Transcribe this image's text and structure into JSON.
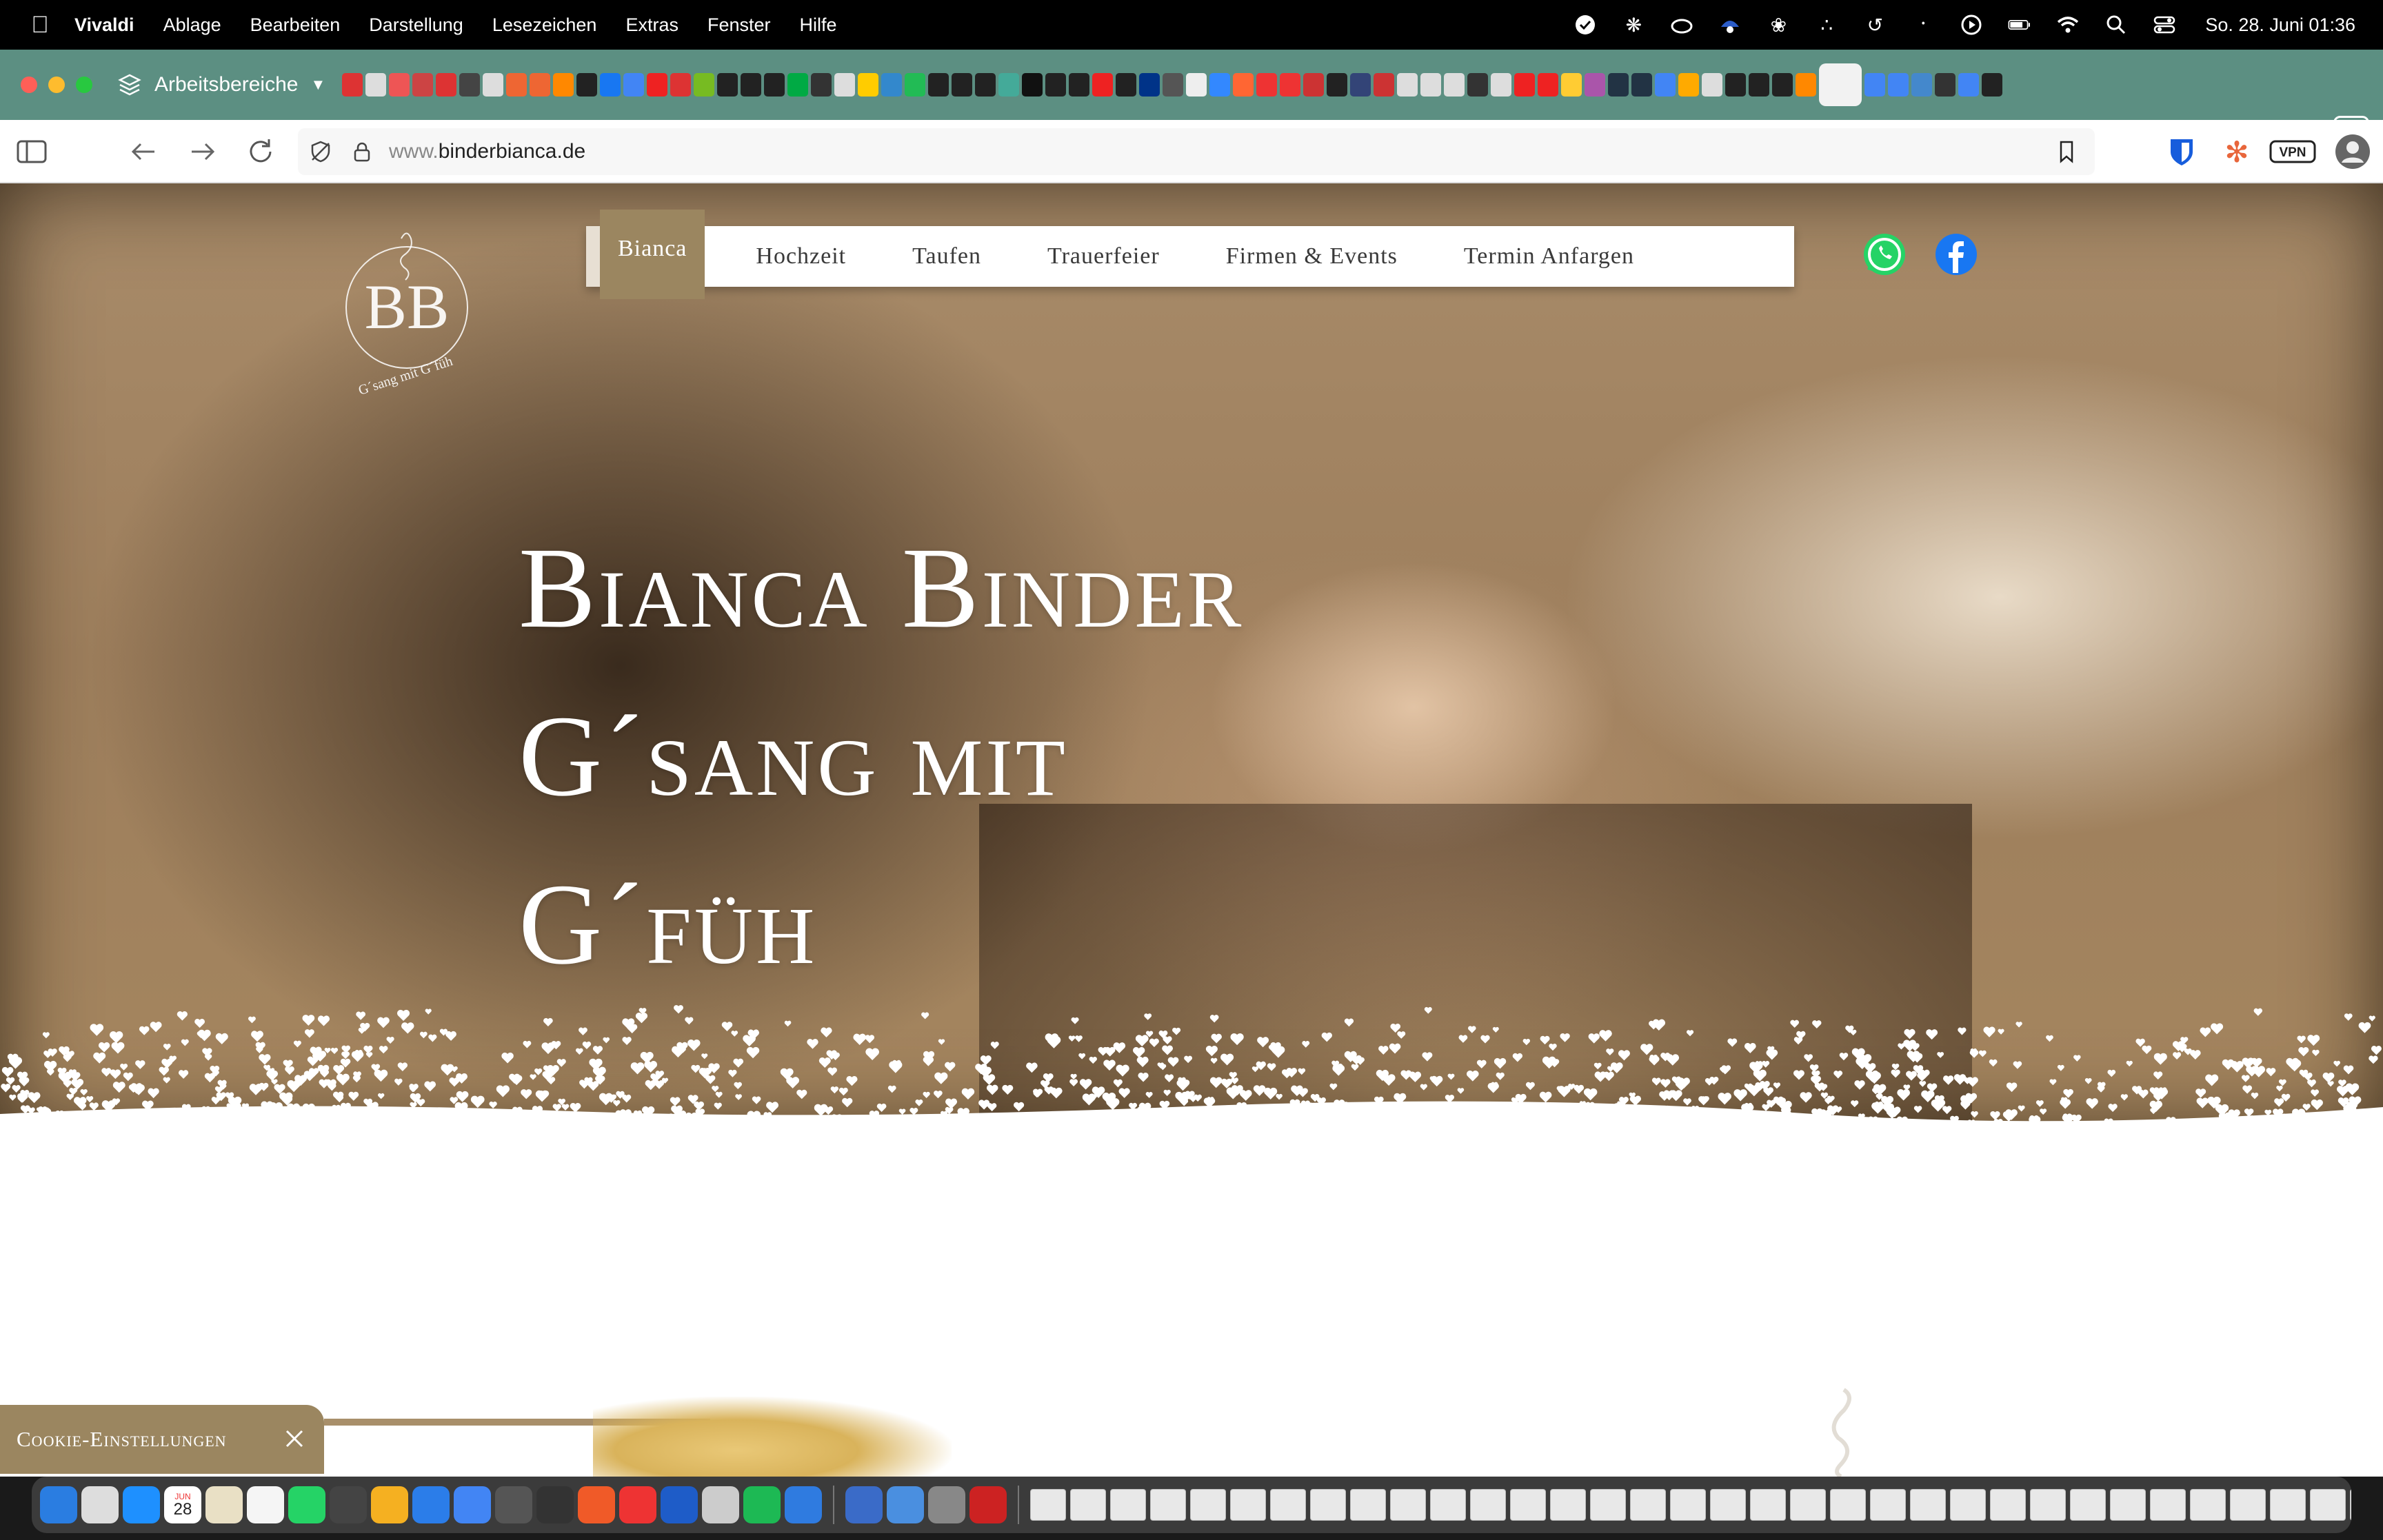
{
  "menubar": {
    "app_name": "Vivaldi",
    "items": [
      "Ablage",
      "Bearbeiten",
      "Darstellung",
      "Lesezeichen",
      "Extras",
      "Fenster",
      "Hilfe"
    ],
    "clock": "So. 28. Juni  01:36"
  },
  "tabbar": {
    "workspace_label": "Arbeitsbereiche",
    "tab_colors": [
      "#d33",
      "#ddd",
      "#e55",
      "#c44",
      "#d33",
      "#444",
      "#ddd",
      "#e63",
      "#e63",
      "#f80",
      "#222",
      "#1877f2",
      "#4285f4",
      "#e22",
      "#d33",
      "#7b2",
      "#222",
      "#222",
      "#222",
      "#0a4",
      "#333",
      "#ddd",
      "#fc0",
      "#38c",
      "#2b5",
      "#222",
      "#222",
      "#222",
      "#4a9",
      "#111",
      "#222",
      "#222",
      "#e22",
      "#222",
      "#038",
      "#555",
      "#eee",
      "#38f",
      "#f63",
      "#e33",
      "#e33",
      "#c33",
      "#222",
      "#347",
      "#c33",
      "#ddd",
      "#ddd",
      "#ddd",
      "#333",
      "#ddd",
      "#e22",
      "#e22",
      "#fc3",
      "#a5a",
      "#234",
      "#234",
      "#4285f4",
      "#fa0",
      "#ddd",
      "#222",
      "#222",
      "#222",
      "#f80",
      "#f2f2f2",
      "#4285f4",
      "#4285f4",
      "#48c",
      "#333",
      "#4285f4",
      "#222"
    ]
  },
  "address": {
    "url_prefix": "www.",
    "url_domain": "binderbianca.de"
  },
  "site": {
    "logo_monogram": "BB",
    "logo_tagline": "G´sang mit G´füh",
    "nav": [
      "Bianca",
      "Hochzeit",
      "Taufen",
      "Trauerfeier",
      "Firmen & Events",
      "Termin Anfargen"
    ],
    "hero_line1": "Bianca Binder",
    "hero_line2": "G´sang mit",
    "hero_line3": "G´füh",
    "cookie_label": "Cookie-Einstellungen",
    "accent_color": "#9b8660"
  },
  "dock": {
    "calendar_month": "JUN",
    "calendar_day": "28",
    "app_colors": [
      "#2a7de1",
      "#ddd",
      "#1e90ff",
      "#e9e0c5",
      "#f5f5f5",
      "#25d366",
      "#444",
      "#f5b021",
      "#2b7de9",
      "#4285f4",
      "#555",
      "#333",
      "#f05a28",
      "#e33",
      "#1e5cc8",
      "#ccc",
      "#1db954",
      "#2f7be0"
    ],
    "app_colors_2": [
      "#3a6bc8",
      "#4a8fe0",
      "#888",
      "#c22"
    ]
  }
}
